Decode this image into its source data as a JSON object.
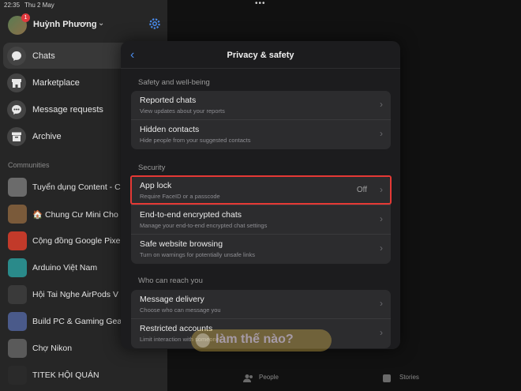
{
  "status_bar": {
    "time": "22:35",
    "date": "Thu 2 May"
  },
  "profile": {
    "name": "Huỳnh Phương",
    "badge": "1"
  },
  "nav": [
    {
      "label": "Chats",
      "icon": "chat-bubble-icon"
    },
    {
      "label": "Marketplace",
      "icon": "store-icon"
    },
    {
      "label": "Message requests",
      "icon": "message-request-icon"
    },
    {
      "label": "Archive",
      "icon": "archive-box-icon"
    }
  ],
  "communities": {
    "caption": "Communities",
    "items": [
      {
        "label": "Tuyển dụng Content - C",
        "color": "#6b6b6b"
      },
      {
        "label": "🏠 Chung Cư Mini Cho",
        "color": "#7a5a3a"
      },
      {
        "label": "Cộng đồng Google Pixe",
        "color": "#c23a2a"
      },
      {
        "label": "Arduino Việt Nam",
        "color": "#2a8a8a"
      },
      {
        "label": "Hội Tai Nghe AirPods V",
        "color": "#3a3a3a"
      },
      {
        "label": "Build PC & Gaming Gea",
        "color": "#4a5a8a"
      },
      {
        "label": "Chợ Nikon",
        "color": "#5a5a5a"
      },
      {
        "label": "TITEK HỘI QUÁN",
        "color": "#2a2a2a"
      }
    ]
  },
  "modal": {
    "title": "Privacy & safety",
    "groups": [
      {
        "caption": "Safety and well-being",
        "rows": [
          {
            "title": "Reported chats",
            "subtitle": "View updates about your reports",
            "value": ""
          },
          {
            "title": "Hidden contacts",
            "subtitle": "Hide people from your suggested contacts",
            "value": ""
          }
        ]
      },
      {
        "caption": "Security",
        "rows": [
          {
            "title": "App lock",
            "subtitle": "Require FaceID or a passcode",
            "value": "Off"
          },
          {
            "title": "End-to-end encrypted chats",
            "subtitle": "Manage your end-to-end encrypted chat settings",
            "value": ""
          },
          {
            "title": "Safe website browsing",
            "subtitle": "Turn on warnings for potentially unsafe links",
            "value": ""
          }
        ]
      },
      {
        "caption": "Who can reach you",
        "rows": [
          {
            "title": "Message delivery",
            "subtitle": "Choose who can message you",
            "value": ""
          },
          {
            "title": "Restricted accounts",
            "subtitle": "Limit interaction with someone",
            "value": ""
          }
        ]
      }
    ]
  },
  "bottom_tabs": {
    "people": "People",
    "stories": "Stories"
  },
  "watermark": "làm thế nào?",
  "colors": {
    "accent": "#4a8bea",
    "highlight": "#e53935",
    "badge": "#e0393e"
  }
}
